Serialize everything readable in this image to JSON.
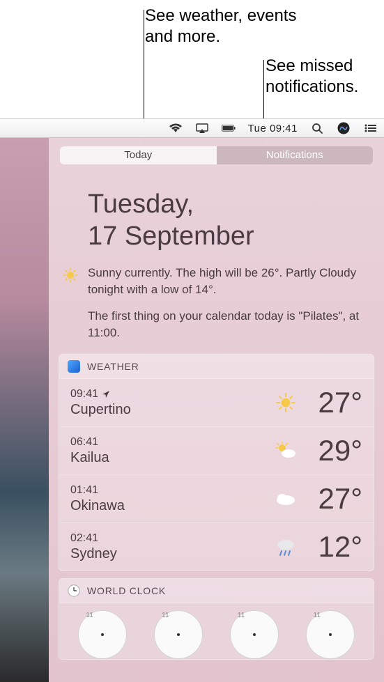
{
  "callouts": {
    "today": "See weather, events and more.",
    "notifications": "See missed notifications."
  },
  "menubar": {
    "clock": "Tue 09:41"
  },
  "tabs": {
    "today": "Today",
    "notifications": "Notifications"
  },
  "date": {
    "line1": "Tuesday,",
    "line2": "17 September"
  },
  "summary": {
    "weather": "Sunny currently. The high will be 26°. Partly Cloudy tonight with a low of 14°.",
    "calendar": "The first thing on your calendar today is \"Pilates\", at 11:00."
  },
  "weather_widget": {
    "title": "WEATHER",
    "rows": [
      {
        "time": "09:41",
        "current": true,
        "city": "Cupertino",
        "icon": "sunny",
        "temp": "27°"
      },
      {
        "time": "06:41",
        "current": false,
        "city": "Kailua",
        "icon": "partly",
        "temp": "29°"
      },
      {
        "time": "01:41",
        "current": false,
        "city": "Okinawa",
        "icon": "cloud",
        "temp": "27°"
      },
      {
        "time": "02:41",
        "current": false,
        "city": "Sydney",
        "icon": "rain",
        "temp": "12°"
      }
    ]
  },
  "worldclock_widget": {
    "title": "WORLD CLOCK"
  }
}
